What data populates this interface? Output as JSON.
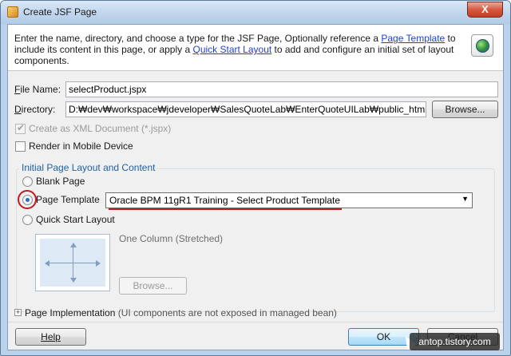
{
  "window": {
    "title": "Create JSF Page",
    "close_glyph": "X"
  },
  "header": {
    "text_1": "Enter the name, directory, and choose a type for the JSF Page, Optionally reference a ",
    "link_1": "Page Template",
    "text_2": " to include its content in this page, or apply a ",
    "link_2": "Quick Start Layout",
    "text_3": " to add and configure an initial set of layout components.",
    "icon": "globe-icon"
  },
  "form": {
    "file_name_label_u": "F",
    "file_name_label_rest": "ile Name:",
    "file_name_value": "selectProduct.jspx",
    "directory_label_u": "D",
    "directory_label_rest": "irectory:",
    "directory_value": "D:₩dev₩workspace₩jdeveloper₩SalesQuoteLab₩EnterQuoteUILab₩public_html",
    "browse_label": "Browse...",
    "xml_doc_label": "Create as XML Document (*.jspx)",
    "xml_doc_checked": true,
    "mobile_label": "Render in Mobile Device",
    "mobile_checked": false
  },
  "layout_group": {
    "title": "Initial Page Layout and Content",
    "blank_page": "Blank Page",
    "page_template": "Page Template",
    "template_selected": "Oracle BPM 11gR1 Training - Select Product Template",
    "quick_start": "Quick Start Layout",
    "quick_start_desc": "One Column (Stretched)",
    "browse_disabled": "Browse...",
    "selected_option": "Page Template"
  },
  "page_impl": {
    "label": "Page Implementation",
    "note": " (UI components are not exposed in managed bean)"
  },
  "footer": {
    "help": "Help",
    "ok": "OK",
    "cancel": "Cancel"
  },
  "watermark": "antop.tistory.com",
  "colors": {
    "accent_link": "#1f3fcf",
    "annotation_red": "#c0191f",
    "group_title": "#1f5f9e"
  }
}
